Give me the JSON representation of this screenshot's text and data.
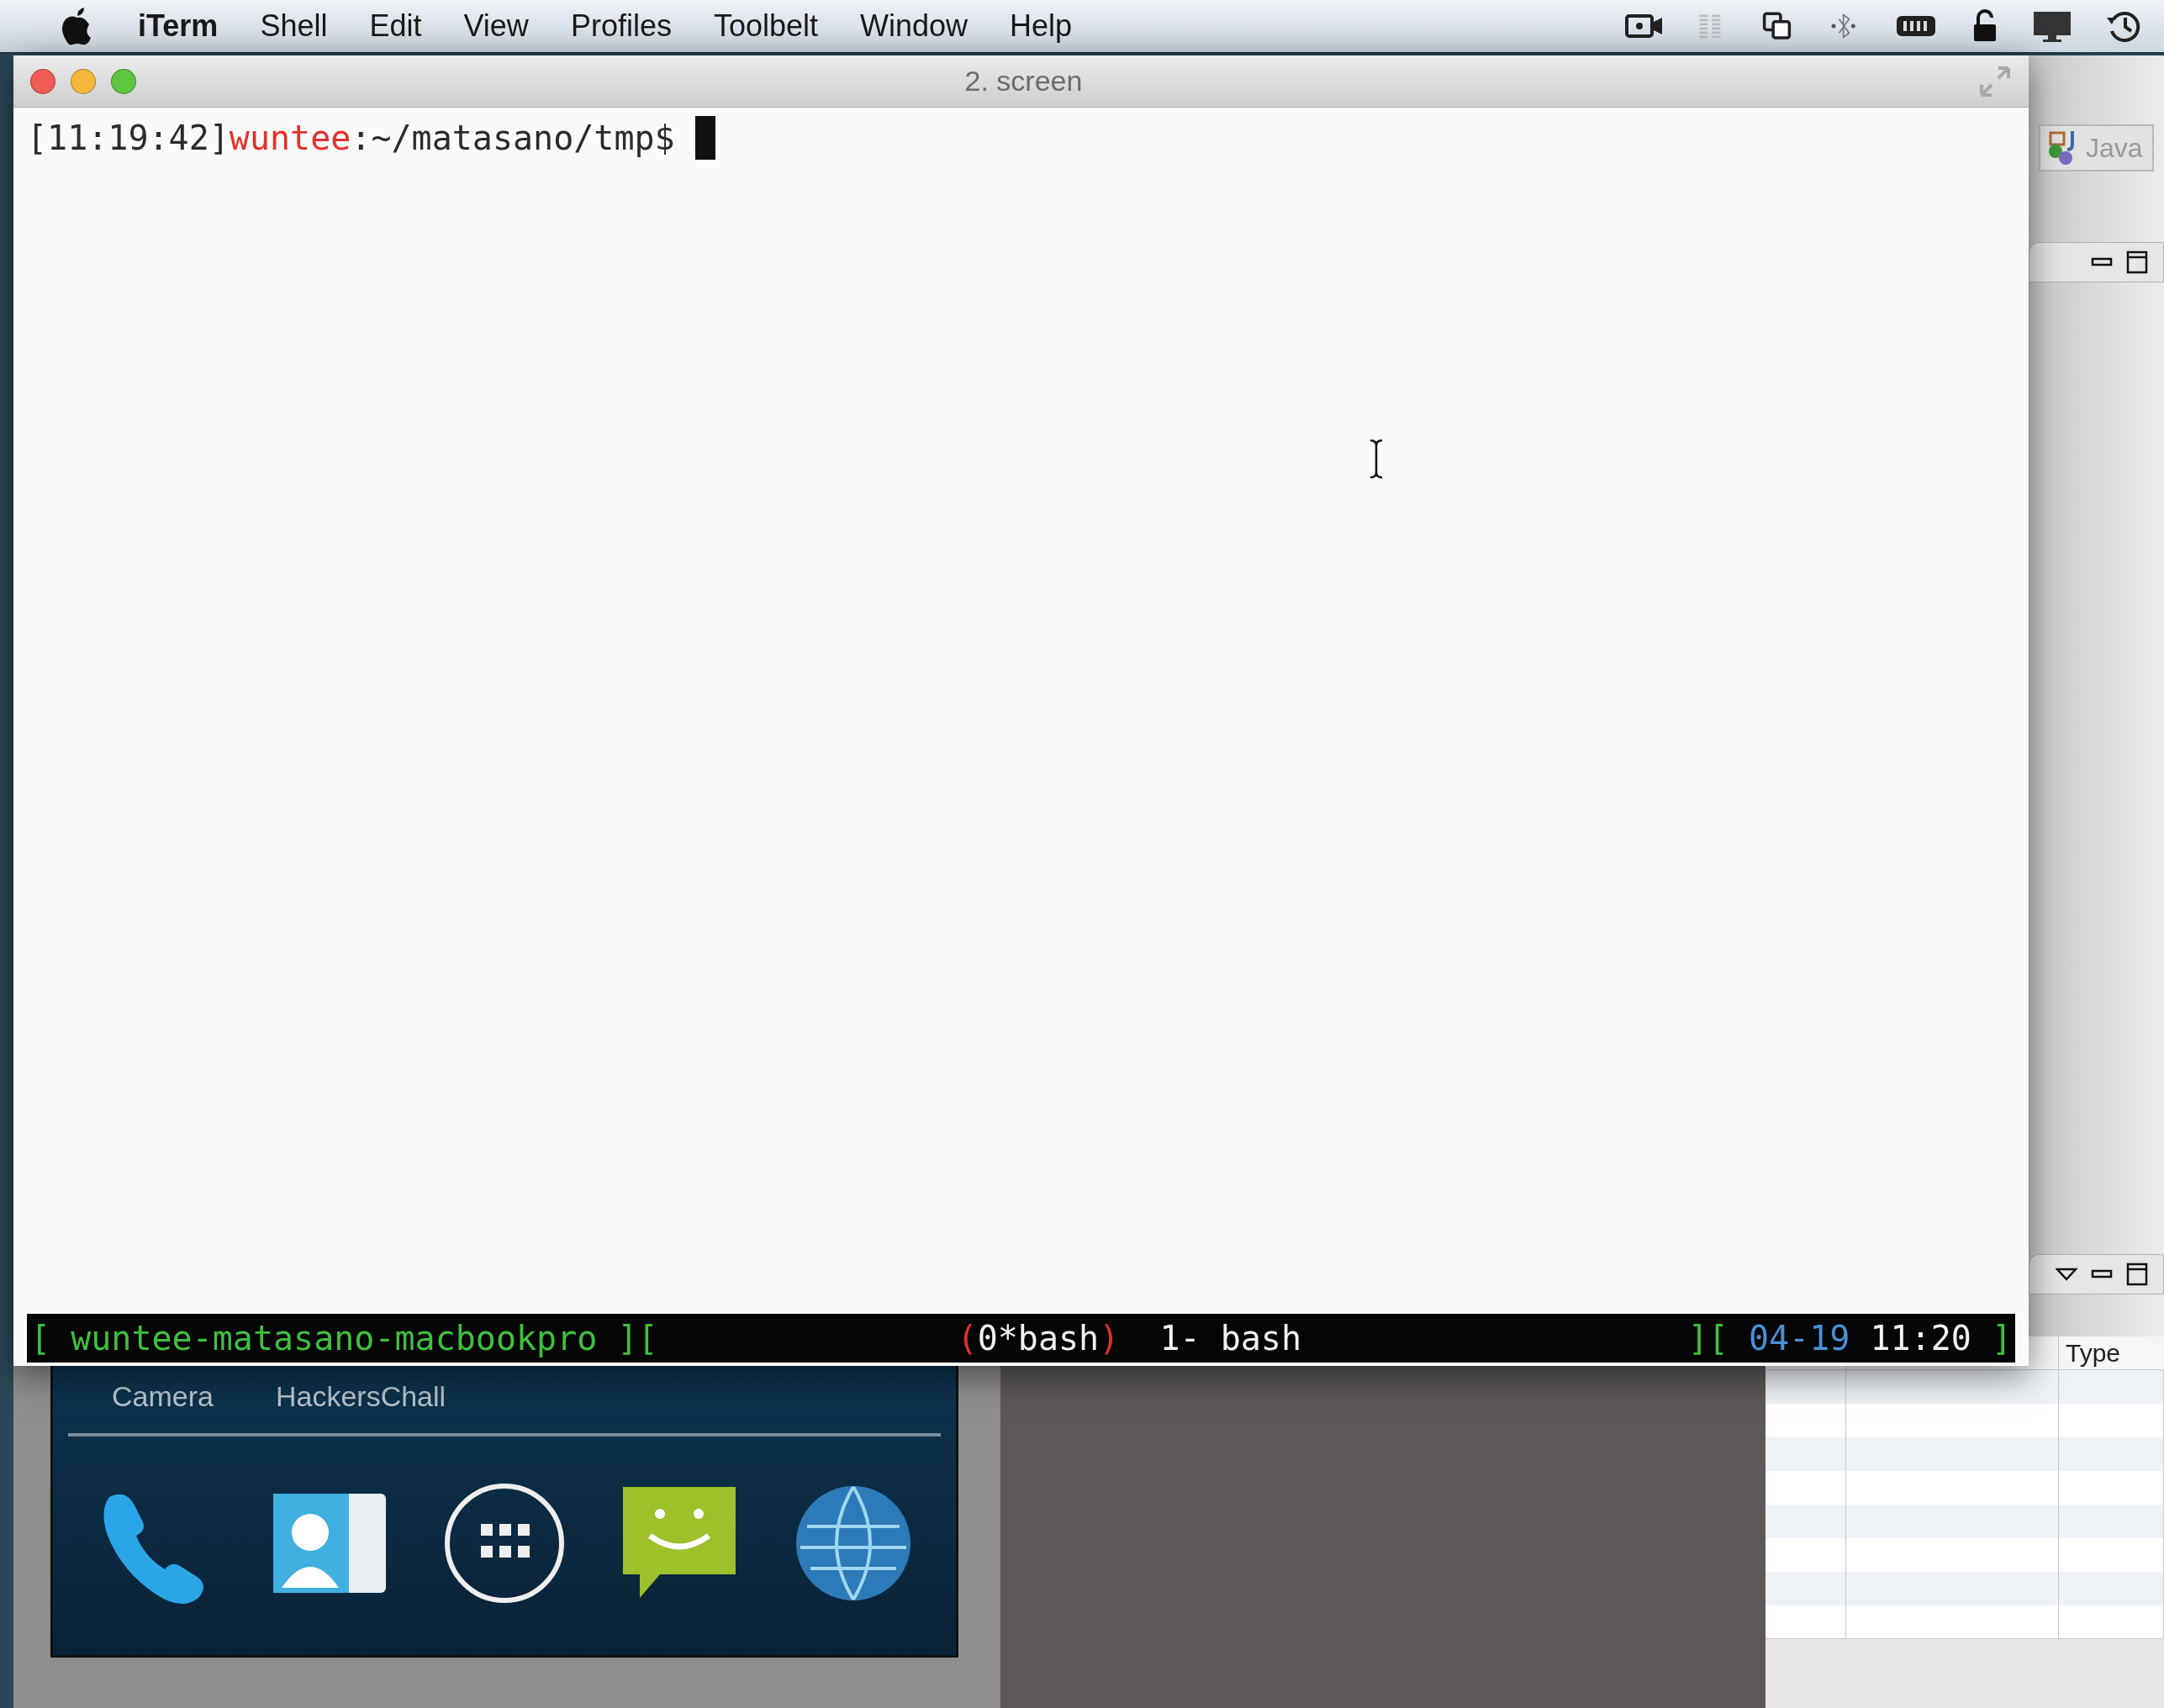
{
  "menu_bar": {
    "app": "iTerm",
    "items": [
      "Shell",
      "Edit",
      "View",
      "Profiles",
      "Toolbelt",
      "Window",
      "Help"
    ]
  },
  "terminal": {
    "title": "2. screen",
    "prompt": [
      {
        "text": "[11:19:42]",
        "color": "#2b2b2b"
      },
      {
        "text": "wuntee",
        "color": "#e3312b"
      },
      {
        "text": ":~/matasano/tmp$",
        "color": "#2b2b2b"
      }
    ],
    "status_left": [
      {
        "text": "[ wuntee-matasano-macbookpro ][",
        "color": "#3fbf3f"
      }
    ],
    "status_middle": [
      {
        "text": "(",
        "color": "#e3312b"
      },
      {
        "text": "0*bash",
        "color": "#f2f2f2"
      },
      {
        "text": ")",
        "color": "#e3312b"
      },
      {
        "text": "  1- bash",
        "color": "#f2f2f2"
      }
    ],
    "status_right": [
      {
        "text": "][ ",
        "color": "#3fbf3f"
      },
      {
        "text": "04-19",
        "color": "#4a8fd8"
      },
      {
        "text": " 11:20",
        "color": "#f2f2f2"
      },
      {
        "text": " ]",
        "color": "#3fbf3f"
      }
    ]
  },
  "eclipse": {
    "perspective": "Java",
    "table_header": "Type"
  },
  "emulator": {
    "app_labels": [
      "Camera",
      "HackersChall"
    ]
  }
}
